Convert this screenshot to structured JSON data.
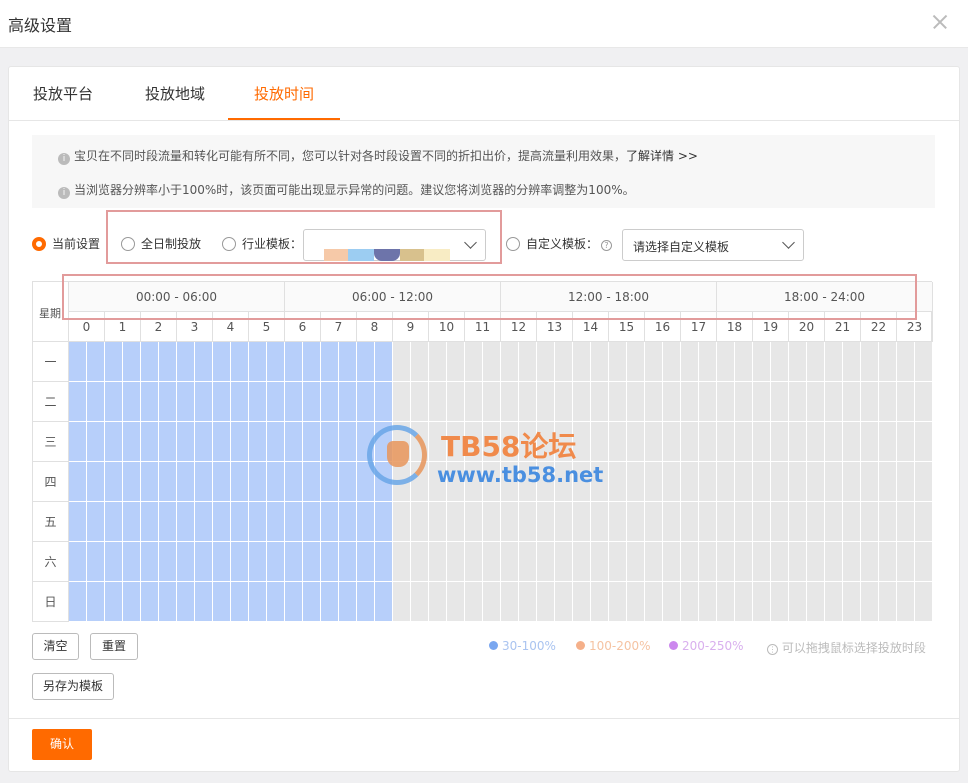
{
  "modal": {
    "title": "高级设置"
  },
  "tabs": [
    {
      "label": "投放平台"
    },
    {
      "label": "投放地域"
    },
    {
      "label": "投放时间",
      "active": true
    }
  ],
  "notice": {
    "line1_text": "宝贝在不同时段流量和转化可能有所不同，您可以针对各时段设置不同的折扣出价，提高流量利用效果，",
    "line1_link": "了解详情 >>",
    "line2_text": "当浏览器分辨率小于100%时，该页面可能出现显示异常的问题。建议您将浏览器的分辨率调整为100%。"
  },
  "options": {
    "current": "当前设置",
    "all_day": "全日制投放",
    "industry": "行业模板：",
    "custom": "自定义模板：",
    "custom_placeholder": "请选择自定义模板",
    "selected": "current"
  },
  "grid": {
    "corner_label": "星期",
    "segments": [
      "00:00 - 06:00",
      "06:00 - 12:00",
      "12:00 - 18:00",
      "18:00 - 24:00"
    ],
    "hours": [
      "0",
      "1",
      "2",
      "3",
      "4",
      "5",
      "6",
      "7",
      "8",
      "9",
      "10",
      "11",
      "12",
      "13",
      "14",
      "15",
      "16",
      "17",
      "18",
      "19",
      "20",
      "21",
      "22",
      "23"
    ],
    "days": [
      "一",
      "二",
      "三",
      "四",
      "五",
      "六",
      "日"
    ],
    "active_hours_through": 8
  },
  "buttons": {
    "clear": "清空",
    "reset": "重置",
    "save_template": "另存为模板",
    "confirm": "确认"
  },
  "legend": {
    "items": [
      {
        "label": "30-100%",
        "color": "#7aa7f0"
      },
      {
        "label": "100-200%",
        "color": "#f5b08a"
      },
      {
        "label": "200-250%",
        "color": "#cc88ee"
      }
    ],
    "hint": "可以拖拽鼠标选择投放时段"
  },
  "watermark": {
    "title": "TB58论坛",
    "url": "www.tb58.net"
  },
  "colors": {
    "accent": "#ff6a00",
    "cell_active": "#b7cffa",
    "cell_idle": "#e7e7e7",
    "highlight_box": "#e29b9b"
  }
}
